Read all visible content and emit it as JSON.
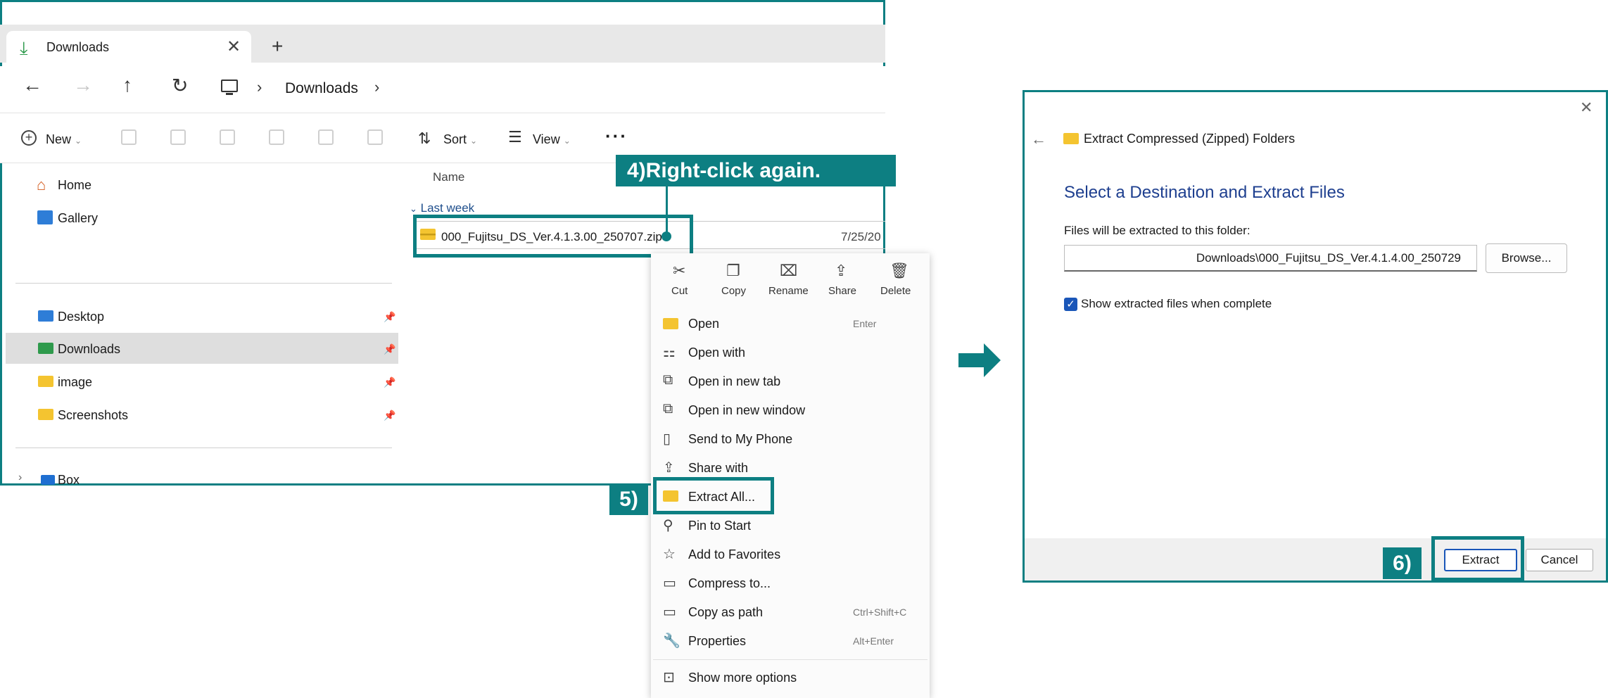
{
  "explorer": {
    "tab_title": "Downloads",
    "tab_close_glyph": "✕",
    "tab_new_glyph": "+",
    "breadcrumb": [
      "Downloads"
    ],
    "toolbar": {
      "new_label": "New",
      "sort_label": "Sort",
      "view_label": "View",
      "more_glyph": "···"
    },
    "sidebar": {
      "items_top": [
        {
          "label": "Home",
          "icon": "home-icon"
        },
        {
          "label": "Gallery",
          "icon": "gallery-icon"
        }
      ],
      "items_pinned": [
        {
          "label": "Desktop",
          "icon": "desktop-folder-icon"
        },
        {
          "label": "Downloads",
          "icon": "downloads-folder-icon",
          "selected": true
        },
        {
          "label": "image",
          "icon": "folder-icon"
        },
        {
          "label": "Screenshots",
          "icon": "folder-icon"
        }
      ],
      "box_label": "Box"
    },
    "file_list": {
      "column_name": "Name",
      "group_label": "Last week",
      "file_name": "000_Fujitsu_DS_Ver.4.1.3.00_250707.zip",
      "file_date": "7/25/20"
    }
  },
  "context_menu": {
    "quick_actions": [
      {
        "label": "Cut",
        "icon": "scissors-icon"
      },
      {
        "label": "Copy",
        "icon": "copy-icon"
      },
      {
        "label": "Rename",
        "icon": "rename-icon"
      },
      {
        "label": "Share",
        "icon": "share-icon"
      },
      {
        "label": "Delete",
        "icon": "trash-icon"
      }
    ],
    "items": [
      {
        "label": "Open",
        "shortcut": "Enter",
        "icon": "folder-open-icon"
      },
      {
        "label": "Open with",
        "shortcut": "",
        "icon": "open-with-icon"
      },
      {
        "label": "Open in new tab",
        "shortcut": "",
        "icon": "new-tab-icon"
      },
      {
        "label": "Open in new window",
        "shortcut": "",
        "icon": "new-window-icon"
      },
      {
        "label": "Send to My Phone",
        "shortcut": "",
        "icon": "phone-icon"
      },
      {
        "label": "Share with",
        "shortcut": "",
        "icon": "share-with-icon"
      },
      {
        "label": "Extract All...",
        "shortcut": "",
        "icon": "extract-icon"
      },
      {
        "label": "Pin to Start",
        "shortcut": "",
        "icon": "pin-icon"
      },
      {
        "label": "Add to Favorites",
        "shortcut": "",
        "icon": "star-icon"
      },
      {
        "label": "Compress to...",
        "shortcut": "",
        "icon": "compress-icon"
      },
      {
        "label": "Copy as path",
        "shortcut": "Ctrl+Shift+C",
        "icon": "copy-path-icon"
      },
      {
        "label": "Properties",
        "shortcut": "Alt+Enter",
        "icon": "wrench-icon"
      },
      {
        "label": "Show more options",
        "shortcut": "",
        "icon": "more-options-icon"
      }
    ]
  },
  "callouts": {
    "step4": "4)Right-click again.",
    "step5": "5)",
    "step6": "6)"
  },
  "dialog": {
    "title": "Extract Compressed (Zipped) Folders",
    "heading": "Select a Destination and Extract Files",
    "destination_hint": "Files will be extracted to this folder:",
    "destination_path": "Downloads\\000_Fujitsu_DS_Ver.4.1.4.00_250729",
    "browse_label": "Browse...",
    "checkbox_label": "Show extracted files when complete",
    "checkbox_checked": true,
    "extract_label": "Extract",
    "cancel_label": "Cancel"
  },
  "colors": {
    "accent_teal": "#0d7f82",
    "heading_blue": "#1e3f8f",
    "checkbox_blue": "#1a56b8"
  }
}
